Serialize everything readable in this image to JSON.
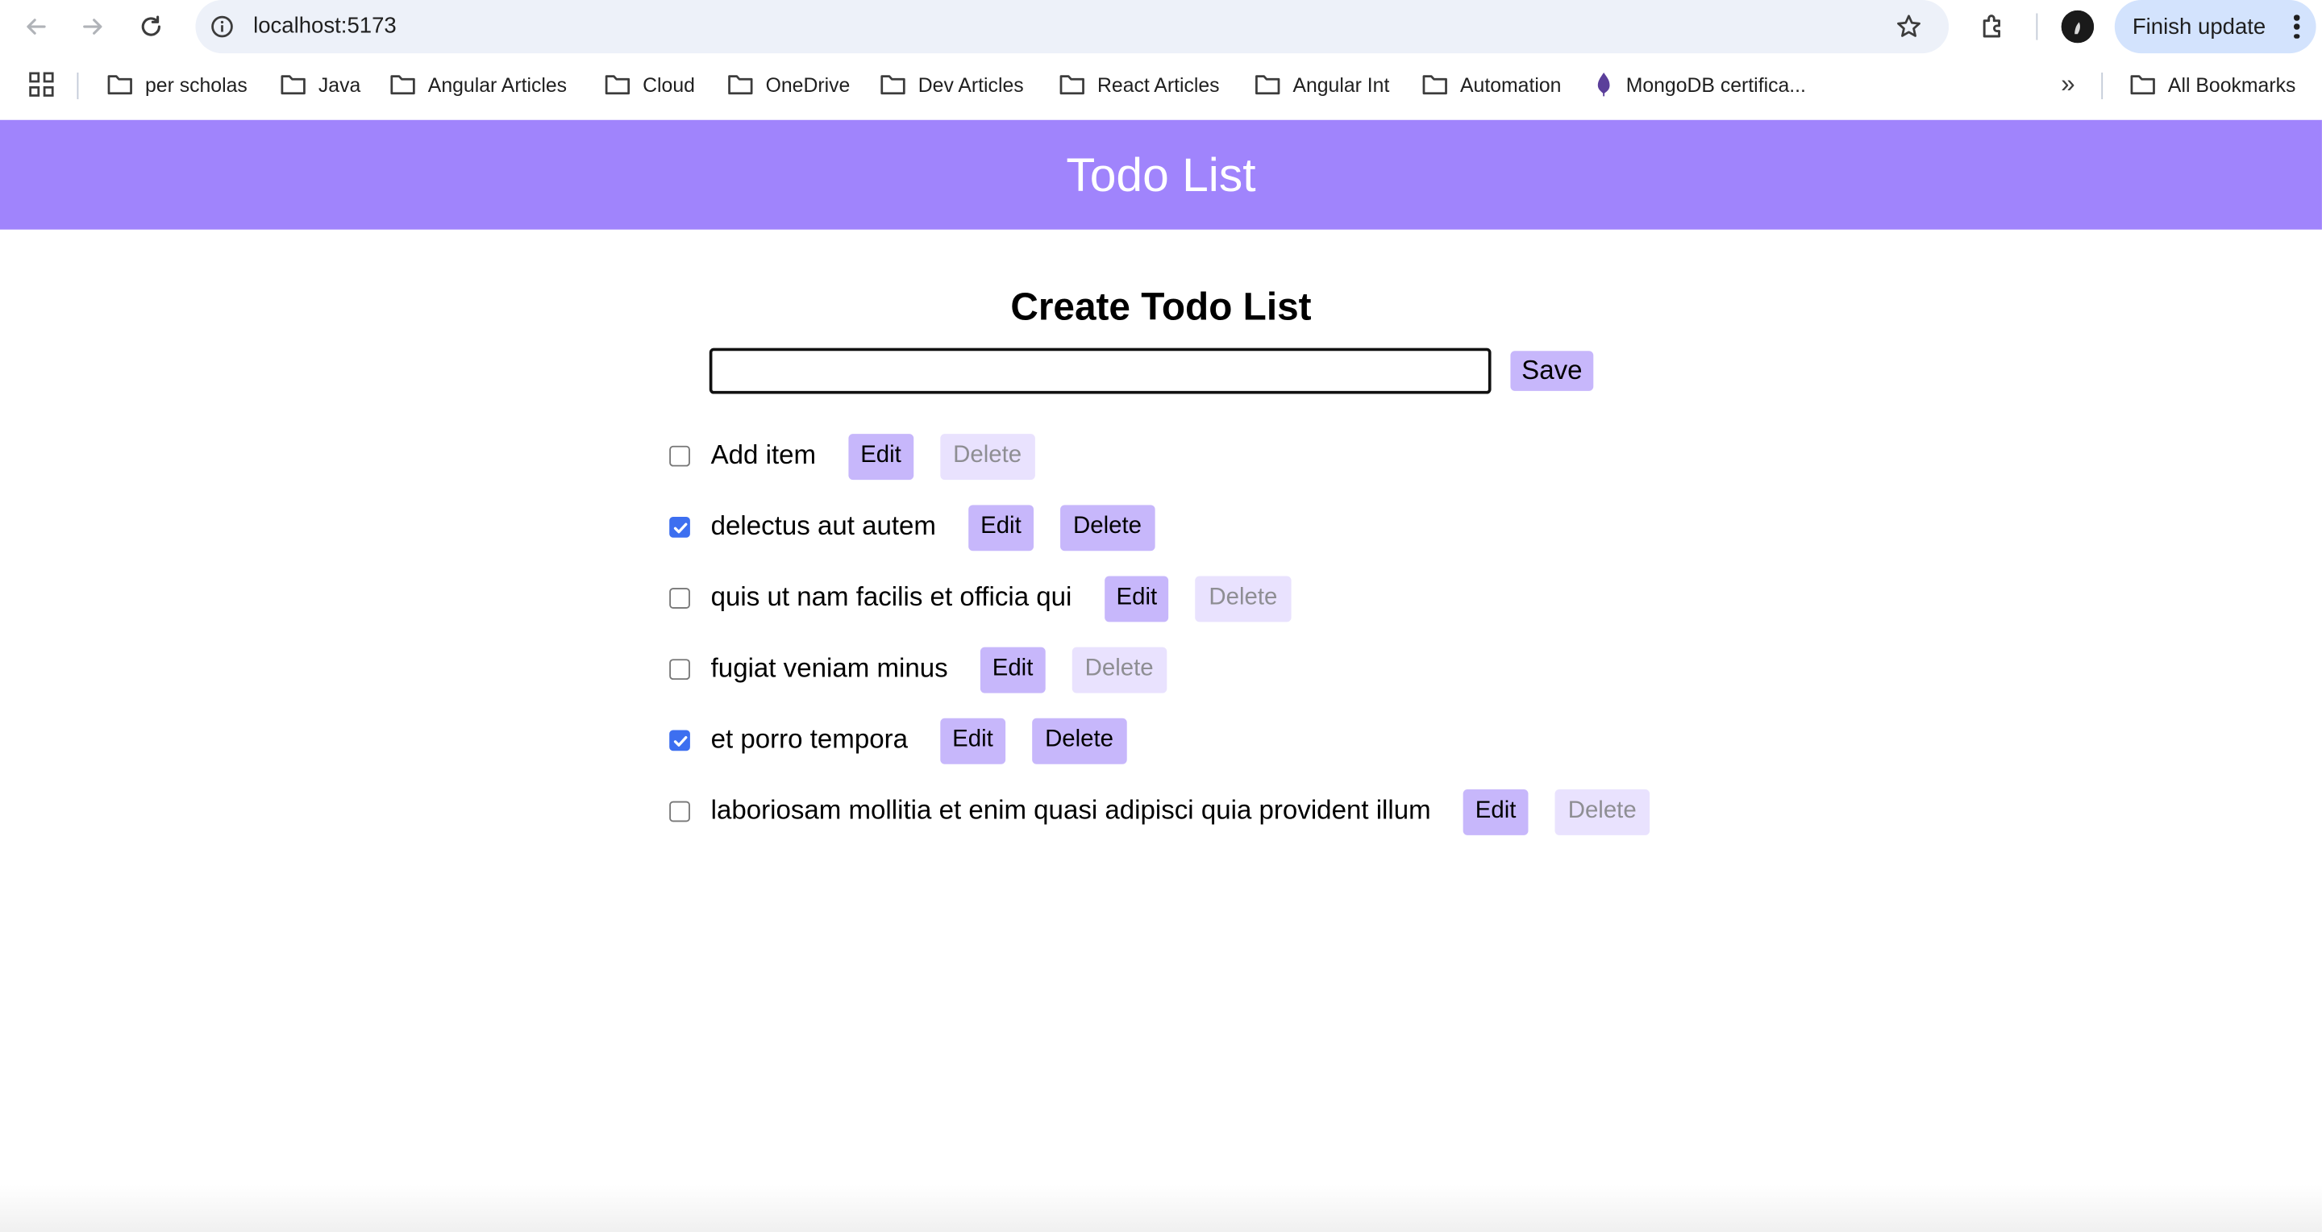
{
  "browser": {
    "url": "localhost:5173",
    "finish_update_label": "Finish update",
    "bookmarks": [
      {
        "label": "per scholas",
        "icon": "folder-icon"
      },
      {
        "label": "Java",
        "icon": "folder-icon"
      },
      {
        "label": "Angular Articles",
        "icon": "folder-icon"
      },
      {
        "label": "Cloud",
        "icon": "folder-icon"
      },
      {
        "label": "OneDrive",
        "icon": "folder-icon"
      },
      {
        "label": "Dev Articles",
        "icon": "folder-icon"
      },
      {
        "label": "React Articles",
        "icon": "folder-icon"
      },
      {
        "label": "Angular Int",
        "icon": "folder-icon"
      },
      {
        "label": "Automation",
        "icon": "folder-icon"
      },
      {
        "label": "MongoDB certifica...",
        "icon": "mongodb-icon"
      }
    ],
    "all_bookmarks_label": "All Bookmarks",
    "more_label": "»"
  },
  "app": {
    "title": "Todo List",
    "create_title": "Create Todo List",
    "input_value": "",
    "save_label": "Save",
    "edit_label": "Edit",
    "delete_label": "Delete",
    "accent_color": "#a084fc",
    "button_color": "#c7b7fb",
    "todos": [
      {
        "text": "Add item",
        "completed": false
      },
      {
        "text": "delectus aut autem",
        "completed": true
      },
      {
        "text": "quis ut nam facilis et officia qui",
        "completed": false
      },
      {
        "text": "fugiat veniam minus",
        "completed": false
      },
      {
        "text": "et porro tempora",
        "completed": true
      },
      {
        "text": "laboriosam mollitia et enim quasi adipisci quia provident illum",
        "completed": false
      }
    ]
  }
}
